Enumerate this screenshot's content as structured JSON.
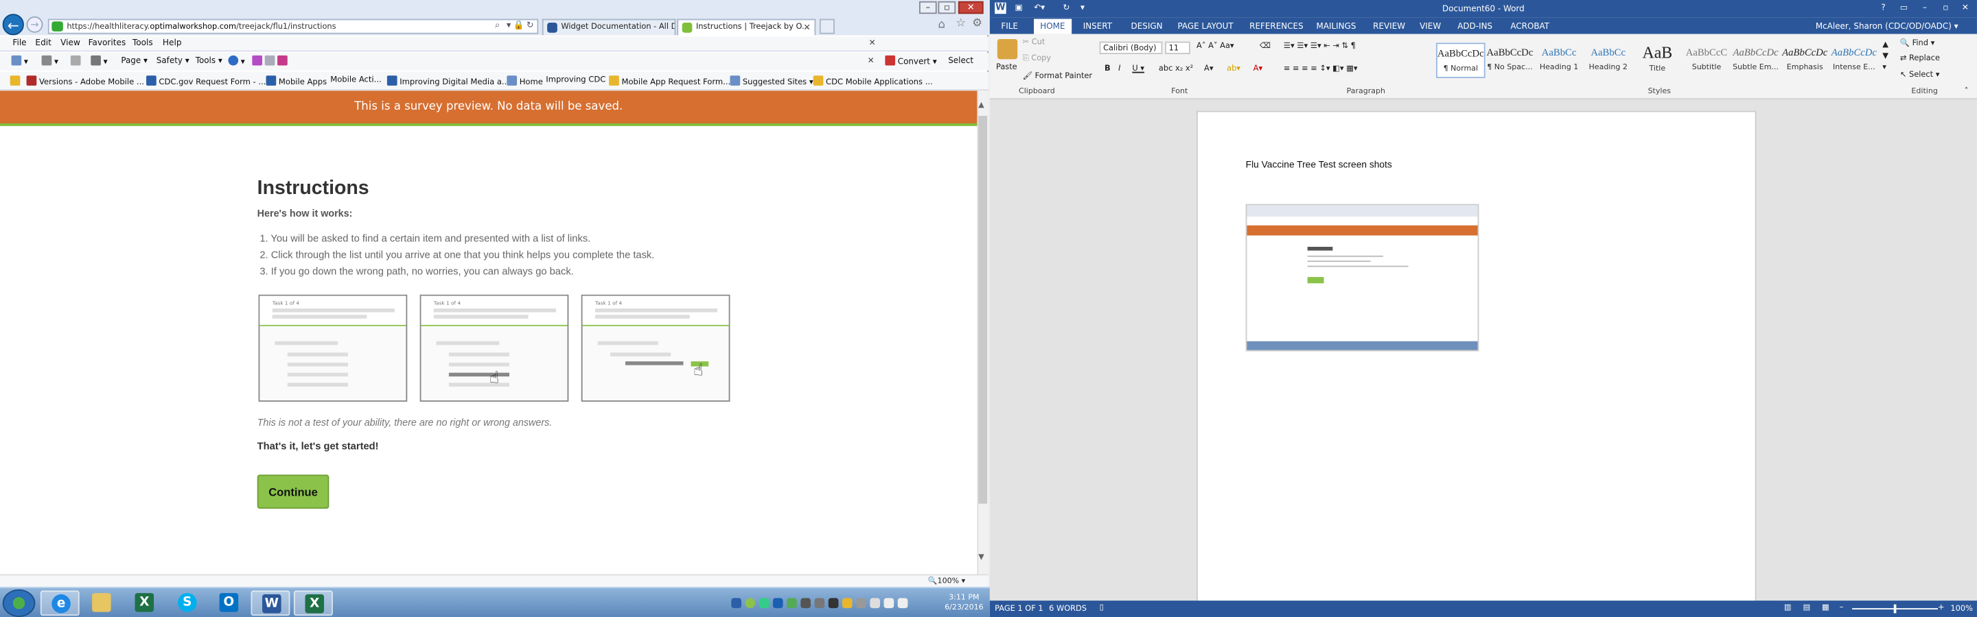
{
  "ie": {
    "url_prefix": "https://healthliteracy.",
    "url_domain": "optimalworkshop.com",
    "url_path": "/treejack/flu1/instructions",
    "tabs": [
      {
        "label": "Widget Documentation - All D...",
        "active": false
      },
      {
        "label": "Instructions | Treejack by O...",
        "active": true
      }
    ],
    "menu": [
      "File",
      "Edit",
      "View",
      "Favorites",
      "Tools",
      "Help"
    ],
    "cmd": {
      "page": "Page",
      "safety": "Safety",
      "tools": "Tools",
      "convert": "Convert",
      "select": "Select"
    },
    "favorites": [
      "Versions - Adobe Mobile ...",
      "CDC.gov Request Form - ...",
      "Mobile Apps",
      "Mobile Acti...",
      "Improving Digital Media a...",
      "Home",
      "Improving CDC",
      "Mobile App Request Form...",
      "Suggested Sites",
      "CDC Mobile Applications ..."
    ],
    "zoom": "100%"
  },
  "survey": {
    "banner": "This is a survey preview. No data will be saved.",
    "title": "Instructions",
    "subtitle": "Here's how it works:",
    "steps": [
      "1.  You will be asked to find a certain item and presented with a list of links.",
      "2.  Click through the list until you arrive at one that you think helps you complete the task.",
      "3.  If you go down the wrong path, no worries, you can always go back."
    ],
    "card_label": "Task 1 of 4",
    "note": "This is not a test of your ability, there are no right or wrong answers.",
    "started": "That's it, let's get started!",
    "continue": "Continue"
  },
  "word": {
    "title": "Document60 - Word",
    "user": "McAleer, Sharon (CDC/OD/OADC)",
    "tabs": [
      "FILE",
      "HOME",
      "INSERT",
      "DESIGN",
      "PAGE LAYOUT",
      "REFERENCES",
      "MAILINGS",
      "REVIEW",
      "VIEW",
      "ADD-INS",
      "ACROBAT"
    ],
    "clipboard": {
      "paste": "Paste",
      "cut": "Cut",
      "copy": "Copy",
      "format_painter": "Format Painter",
      "label": "Clipboard"
    },
    "font": {
      "name": "Calibri (Body)",
      "size": "11",
      "label": "Font"
    },
    "paragraph_label": "Paragraph",
    "styles_label": "Styles",
    "styles": [
      {
        "preview": "AaBbCcDc",
        "name": "¶ Normal"
      },
      {
        "preview": "AaBbCcDc",
        "name": "¶ No Spac..."
      },
      {
        "preview": "AaBbCc",
        "name": "Heading 1"
      },
      {
        "preview": "AaBbCc",
        "name": "Heading 2"
      },
      {
        "preview": "AaB",
        "name": "Title"
      },
      {
        "preview": "AaBbCcC",
        "name": "Subtitle"
      },
      {
        "preview": "AaBbCcDc",
        "name": "Subtle Em..."
      },
      {
        "preview": "AaBbCcDc",
        "name": "Emphasis"
      },
      {
        "preview": "AaBbCcDc",
        "name": "Intense E..."
      }
    ],
    "editing": {
      "find": "Find",
      "replace": "Replace",
      "select": "Select",
      "label": "Editing"
    },
    "doc_text": "Flu Vaccine Tree Test screen shots",
    "status": {
      "page": "PAGE 1 OF 1",
      "words": "6 WORDS",
      "zoom": "100%"
    }
  },
  "taskbar": {
    "time": "3:11 PM",
    "date": "6/23/2016"
  },
  "colors": {
    "banner": "#d66f30",
    "accent_green": "#8bc34a",
    "word_blue": "#2b579a"
  }
}
